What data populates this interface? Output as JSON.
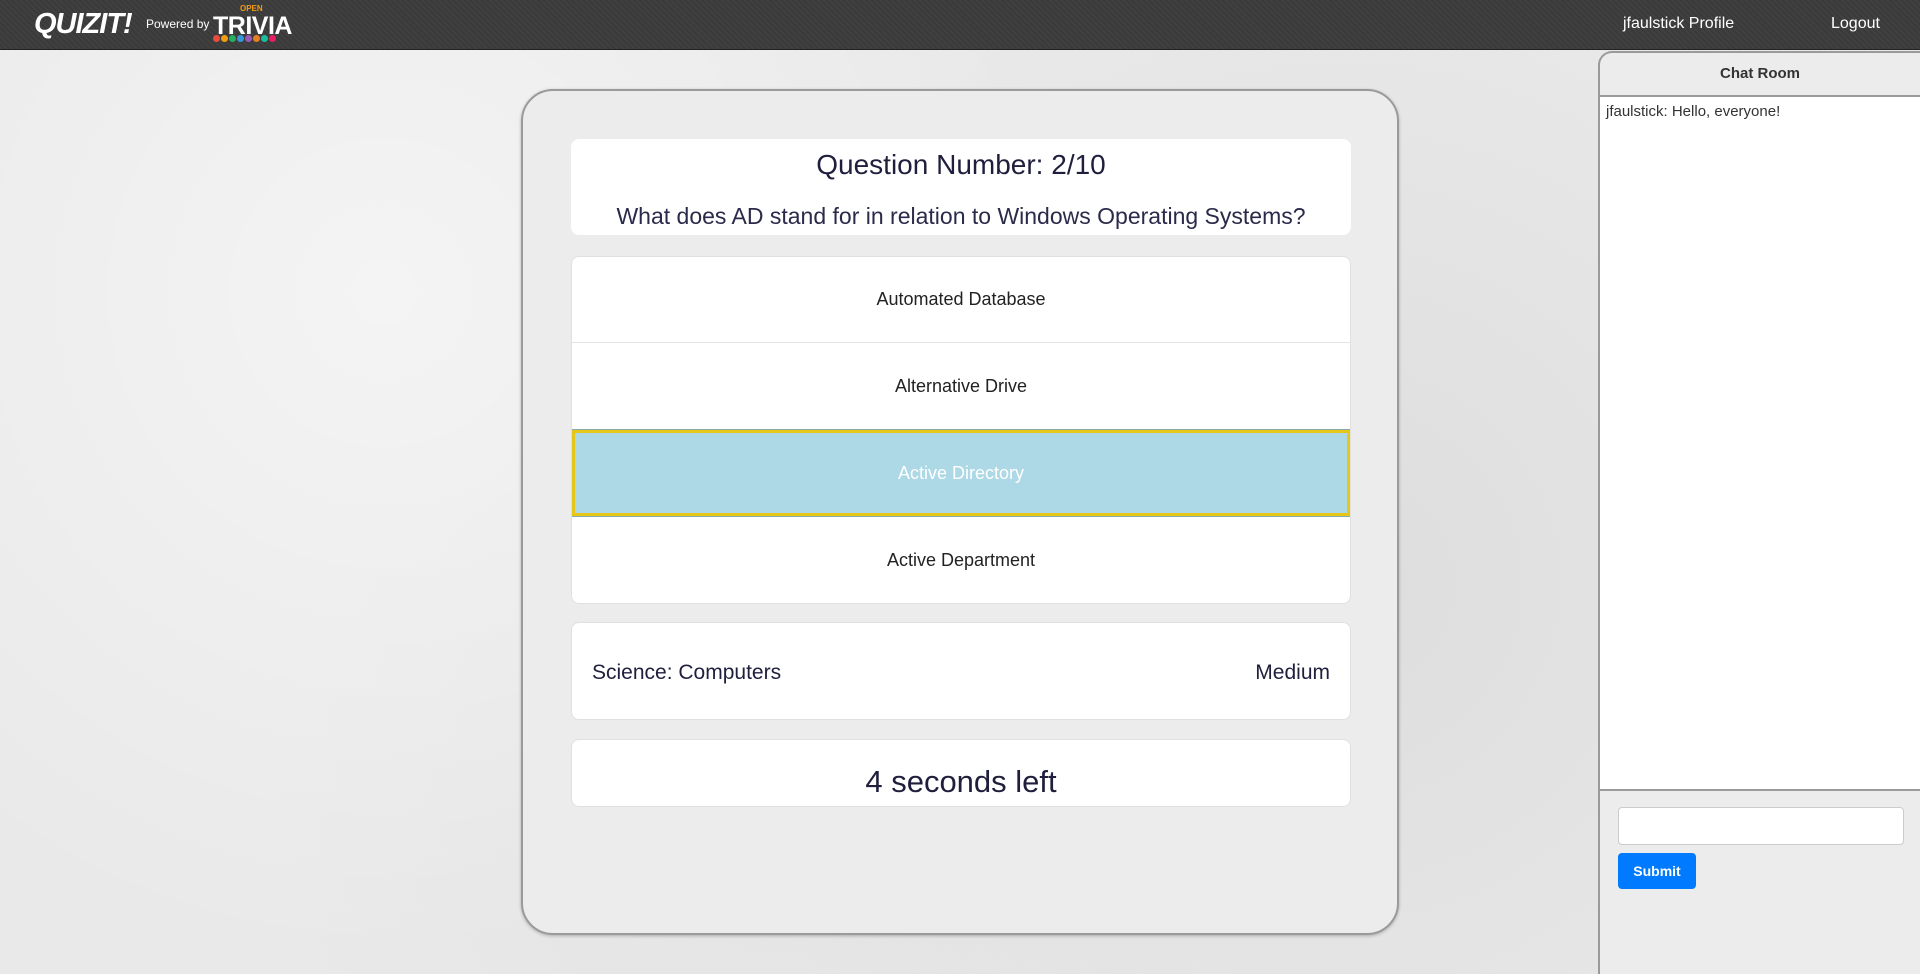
{
  "navbar": {
    "logo": "QUIZIT!",
    "powered_by": "Powered by",
    "trivia_open": "OPEN",
    "trivia_word": "TRIVIA",
    "profile_link": "jfaulstick Profile",
    "logout_link": "Logout"
  },
  "question": {
    "title": "Question Number: 2/10",
    "text": "What does AD stand for in relation to Windows Operating Systems?",
    "answers": [
      {
        "label": "Automated Database",
        "selected": false
      },
      {
        "label": "Alternative Drive",
        "selected": false
      },
      {
        "label": "Active Directory",
        "selected": true
      },
      {
        "label": "Active Department",
        "selected": false
      }
    ],
    "category": "Science: Computers",
    "difficulty": "Medium",
    "timer": "4 seconds left"
  },
  "chat": {
    "title": "Chat Room",
    "messages": [
      "jfaulstick: Hello, everyone!"
    ],
    "input_value": "",
    "submit_label": "Submit"
  },
  "colors": {
    "selected_answer_bg": "#add8e6",
    "selected_answer_border": "#e6c619",
    "submit_button": "#007bff",
    "navbar": "#3a3a3a"
  }
}
